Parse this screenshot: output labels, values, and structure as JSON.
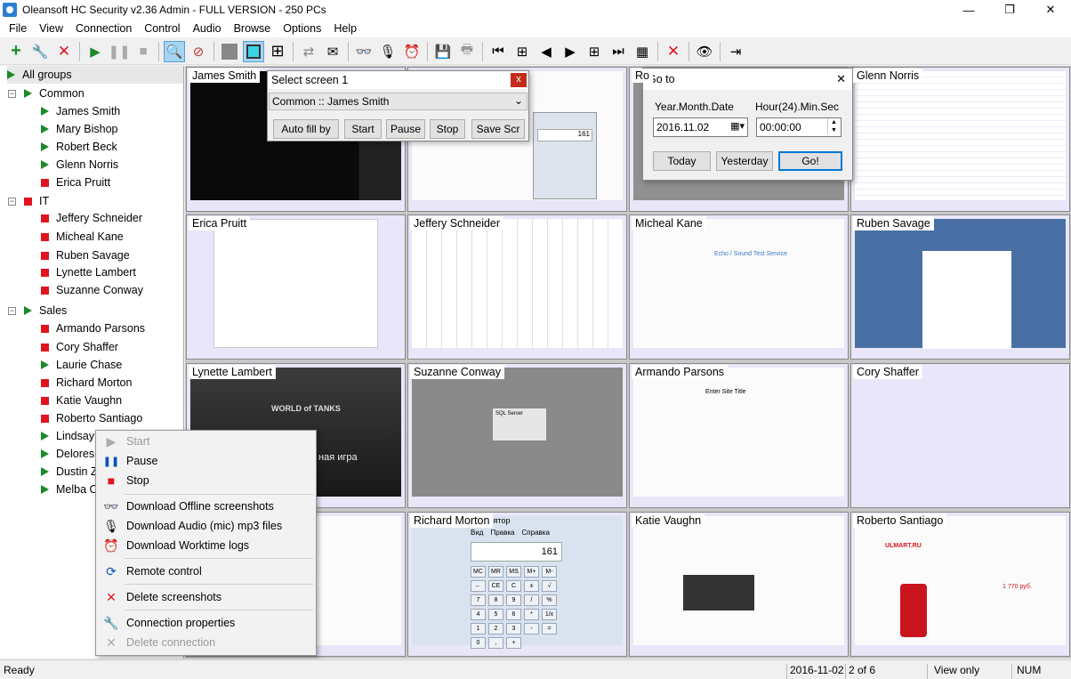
{
  "window": {
    "title": "Oleansoft HC Security v2.36 Admin - FULL VERSION - 250 PCs",
    "min": "—",
    "max": "❐",
    "close": "✕"
  },
  "menu": [
    "File",
    "View",
    "Connection",
    "Control",
    "Audio",
    "Browse",
    "Options",
    "Help"
  ],
  "toolbar_icons": [
    "add-icon",
    "wrench-icon",
    "delete-icon",
    "play-icon",
    "pause-icon",
    "stop-icon",
    "zoom-icon",
    "remote-icon",
    "view-single-icon",
    "view-4-icon",
    "view-9-icon",
    "refresh-icon",
    "mail-icon",
    "binoculars-icon",
    "mic-icon",
    "clock-icon",
    "save-icon",
    "print-icon",
    "first-icon",
    "first-page-icon",
    "prev-icon",
    "next-icon",
    "next-page-icon",
    "last-icon",
    "calendar-icon",
    "close-x-icon",
    "eye-icon",
    "exit-icon"
  ],
  "tree": {
    "root": "All groups",
    "groups": [
      {
        "name": "Common",
        "status": "green",
        "members": [
          {
            "name": "James Smith",
            "status": "green"
          },
          {
            "name": "Mary Bishop",
            "status": "green"
          },
          {
            "name": "Robert Beck",
            "status": "green"
          },
          {
            "name": "Glenn Norris",
            "status": "green"
          },
          {
            "name": "Erica Pruitt",
            "status": "red"
          }
        ]
      },
      {
        "name": "IT",
        "status": "red",
        "members": [
          {
            "name": "Jeffery Schneider",
            "status": "red"
          },
          {
            "name": "Micheal Kane",
            "status": "red"
          },
          {
            "name": "Ruben Savage",
            "status": "red"
          },
          {
            "name": "Lynette Lambert",
            "status": "red"
          },
          {
            "name": "Suzanne Conway",
            "status": "red"
          }
        ]
      },
      {
        "name": "Sales",
        "status": "green",
        "members": [
          {
            "name": "Armando Parsons",
            "status": "red"
          },
          {
            "name": "Cory Shaffer",
            "status": "red"
          },
          {
            "name": "Laurie Chase",
            "status": "green"
          },
          {
            "name": "Richard Morton",
            "status": "red"
          },
          {
            "name": "Katie Vaughn",
            "status": "red"
          },
          {
            "name": "Roberto Santiago",
            "status": "red"
          },
          {
            "name": "Lindsay",
            "status": "green"
          },
          {
            "name": "Delores",
            "status": "green"
          },
          {
            "name": "Dustin Z",
            "status": "green"
          },
          {
            "name": "Melba C",
            "status": "green"
          }
        ]
      }
    ]
  },
  "cells": [
    {
      "label": "James Smith",
      "kind": "dark"
    },
    {
      "label": "",
      "kind": "white"
    },
    {
      "label": "Ro",
      "kind": "grey"
    },
    {
      "label": "Glenn Norris",
      "kind": "white"
    },
    {
      "label": "Erica Pruitt",
      "kind": "white"
    },
    {
      "label": "Jeffery Schneider",
      "kind": "white"
    },
    {
      "label": "Micheal Kane",
      "kind": "white"
    },
    {
      "label": "Ruben Savage",
      "kind": "blue"
    },
    {
      "label": "Lynette Lambert",
      "kind": "dark"
    },
    {
      "label": "Suzanne Conway",
      "kind": "grey"
    },
    {
      "label": "Armando Parsons",
      "kind": "white"
    },
    {
      "label": "Cory Shaffer",
      "kind": "empty"
    },
    {
      "label": "",
      "kind": "white"
    },
    {
      "label": "Richard Morton",
      "kind": "calc"
    },
    {
      "label": "Katie Vaughn",
      "kind": "white"
    },
    {
      "label": "Roberto Santiago",
      "kind": "white"
    }
  ],
  "screen_texts": {
    "world_of_tanks": "WORLD of TANKS",
    "tanks_subtitle": "ная игра",
    "echo_title": "Echo / Sound Test Service",
    "enter_title": "Enter Site Title",
    "calc_title": "улятор",
    "calc_menu": [
      "Вид",
      "Правка",
      "Справка"
    ],
    "calc_display": "161",
    "mini_calc_display": "161",
    "calc_keys": [
      "MC",
      "MR",
      "MS",
      "M+",
      "M-",
      "←",
      "CE",
      "C",
      "±",
      "√",
      "7",
      "8",
      "9",
      "/",
      "%",
      "4",
      "5",
      "6",
      "*",
      "1/x",
      "1",
      "2",
      "3",
      "-",
      "=",
      "0",
      ",",
      "+"
    ],
    "ulmart": "ULMART.RU",
    "sql_server": "SQL Server",
    "price": "1 770 руб."
  },
  "select_screen": {
    "title": "Select screen 1",
    "close": "x",
    "value": "Common :: James Smith",
    "buttons": [
      "Auto fill by",
      "Start",
      "Pause",
      "Stop",
      "Save Scr"
    ]
  },
  "goto": {
    "title": "Go to",
    "close": "✕",
    "date_label": "Year.Month.Date",
    "time_label": "Hour(24).Min.Sec",
    "date_value": "2016.11.02",
    "time_value": "00:00:00",
    "buttons": [
      "Today",
      "Yesterday",
      "Go!"
    ]
  },
  "context_menu": [
    {
      "label": "Start",
      "icon": "play-icon",
      "disabled": true
    },
    {
      "label": "Pause",
      "icon": "pause-icon",
      "disabled": false
    },
    {
      "label": "Stop",
      "icon": "stop-icon",
      "disabled": false
    },
    {
      "label": "Download Offline screenshots",
      "icon": "binoculars-icon",
      "disabled": false
    },
    {
      "label": "Download Audio (mic) mp3 files",
      "icon": "mic-icon",
      "disabled": false
    },
    {
      "label": "Download Worktime logs",
      "icon": "clock-icon",
      "disabled": false
    },
    {
      "label": "Remote control",
      "icon": "remote-icon",
      "disabled": false
    },
    {
      "label": "Delete screenshots",
      "icon": "delete-icon",
      "disabled": false
    },
    {
      "label": "Connection properties",
      "icon": "wrench-icon",
      "disabled": false
    },
    {
      "label": "Delete connection",
      "icon": "delete-icon",
      "disabled": true
    }
  ],
  "status": {
    "left": "Ready",
    "date": "2016-11-02",
    "page": "2 of 6",
    "mode": "View only",
    "num": "NUM"
  },
  "colors": {
    "green": "#1b8a2a",
    "red": "#e0141e",
    "accent": "#0078d7",
    "cell_bg": "#e8e6f8"
  }
}
